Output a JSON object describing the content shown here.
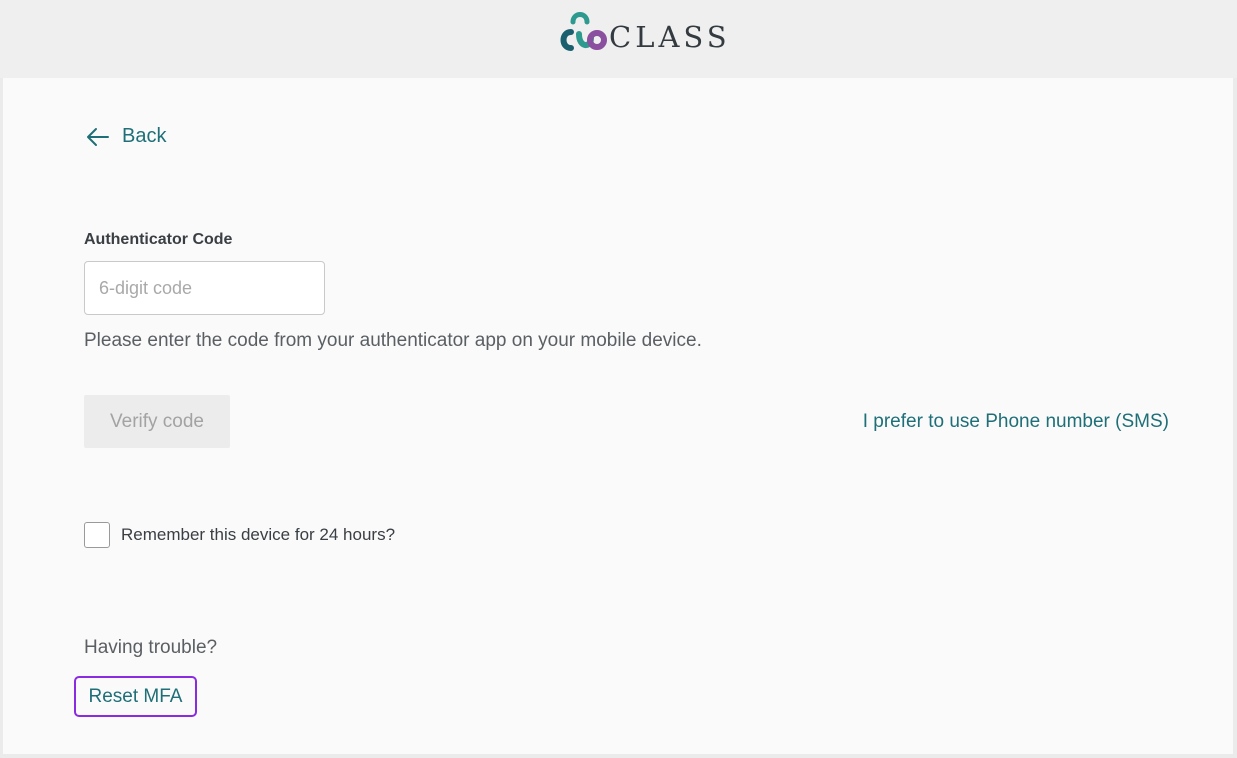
{
  "header": {
    "logo_text": "CLASS",
    "logo_icon": "class-logo-icon"
  },
  "nav": {
    "back_label": "Back",
    "back_icon": "arrow-left-icon"
  },
  "form": {
    "code_label": "Authenticator Code",
    "code_placeholder": "6-digit code",
    "code_value": "",
    "help_text": "Please enter the code from your authenticator app on your mobile device.",
    "verify_label": "Verify code",
    "sms_link": "I prefer to use Phone number (SMS)",
    "remember_label": "Remember this device for 24 hours?",
    "remember_checked": false
  },
  "trouble": {
    "text": "Having trouble?",
    "reset_label": "Reset MFA"
  },
  "colors": {
    "accent": "#1f6f78",
    "focus_outline": "#8a2be2",
    "logo_green": "#2e9a8f",
    "logo_teal": "#1a5f6e",
    "logo_purple": "#8a4f9e"
  }
}
